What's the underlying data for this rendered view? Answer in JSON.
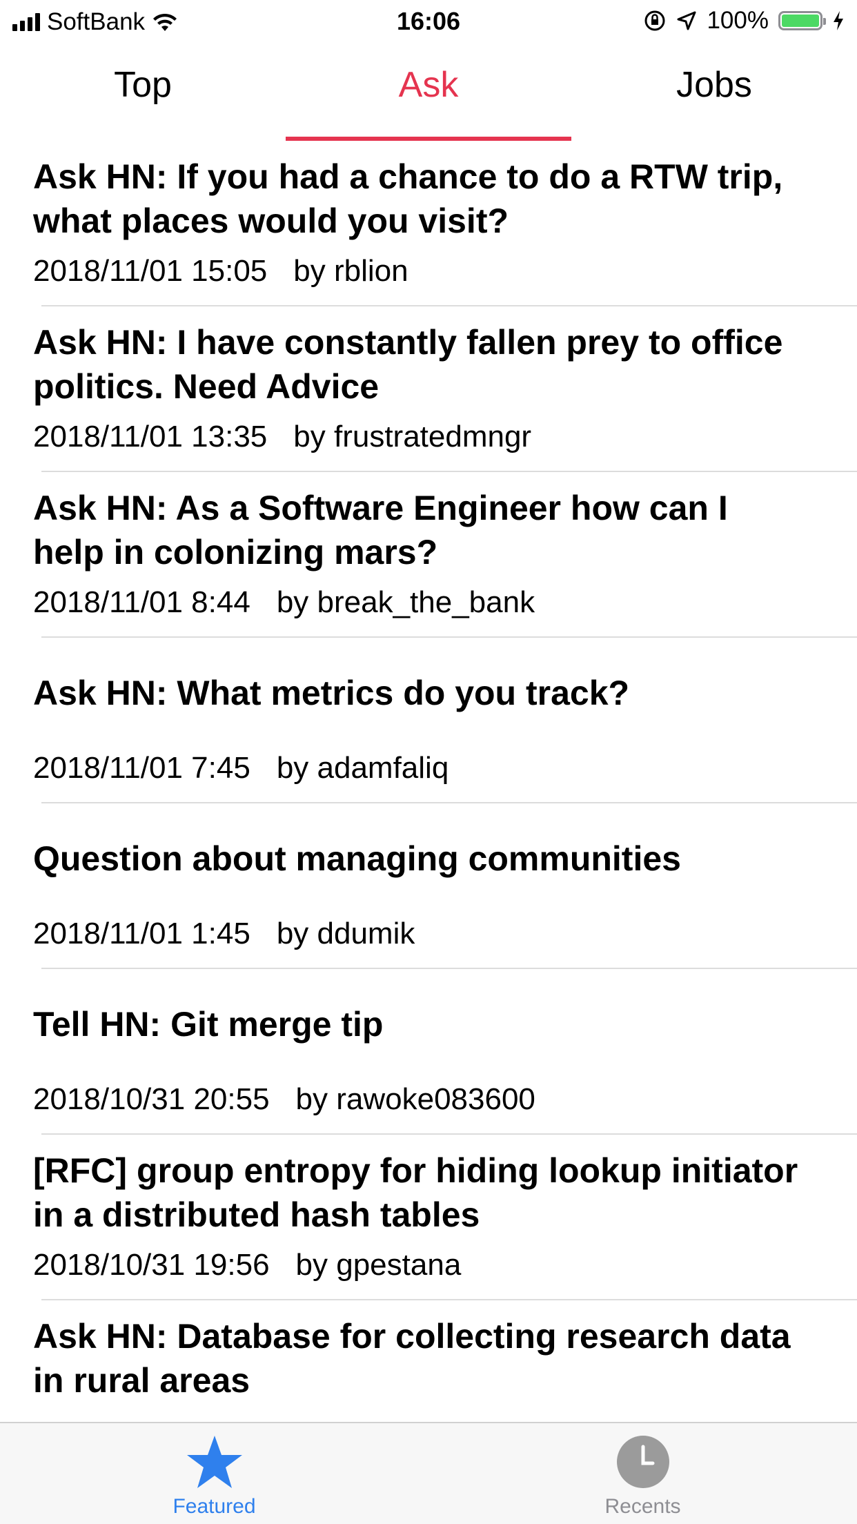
{
  "status_bar": {
    "carrier": "SoftBank",
    "time": "16:06",
    "battery": "100%"
  },
  "tabs": [
    {
      "label": "Top"
    },
    {
      "label": "Ask"
    },
    {
      "label": "Jobs"
    }
  ],
  "active_tab": "Ask",
  "items": [
    {
      "title": "Ask HN: If you had a chance to do a RTW trip, what places would you visit?",
      "date": "2018/11/01 15:05",
      "author": "by rblion"
    },
    {
      "title": "Ask HN: I have constantly fallen prey to office politics. Need Advice",
      "date": "2018/11/01 13:35",
      "author": "by frustratedmngr"
    },
    {
      "title": "Ask HN: As a Software Engineer how can I help in colonizing mars?",
      "date": "2018/11/01 8:44",
      "author": "by break_the_bank"
    },
    {
      "title": "Ask HN: What metrics do you track?",
      "date": "2018/11/01 7:45",
      "author": "by adamfaliq"
    },
    {
      "title": "Question about managing communities",
      "date": "2018/11/01 1:45",
      "author": "by ddumik"
    },
    {
      "title": "Tell HN: Git merge tip",
      "date": "2018/10/31 20:55",
      "author": "by rawoke083600"
    },
    {
      "title": "[RFC] group entropy for hiding lookup initiator in a distributed hash tables",
      "date": "2018/10/31 19:56",
      "author": "by gpestana"
    },
    {
      "title": "Ask HN: Database for collecting research data in rural areas",
      "date": "",
      "author": ""
    }
  ],
  "tab_bar": {
    "featured_label": "Featured",
    "recents_label": "Recents"
  },
  "colors": {
    "accent": "#e5344f",
    "tab_active": "#2f80ed",
    "tab_inactive": "#8e8e93",
    "battery": "#4cd964"
  }
}
